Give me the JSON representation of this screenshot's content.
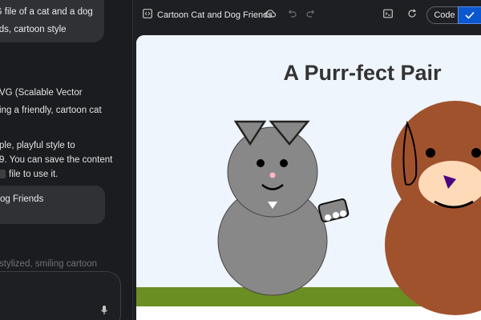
{
  "chat": {
    "request_text": "VG file of a cat and a dog\nends, cartoon style",
    "response_line1": "VG (Scalable Vector",
    "response_line2": "ing a friendly, cartoon cat",
    "response_line3": "ple, playful style to",
    "response_line4": "9. You can save the content",
    "response_line5": "file to use it.",
    "file_chip_label": "og Friends",
    "hint_text": "stylized, smiling cartoon",
    "mic_icon": "mic-icon"
  },
  "toolbar": {
    "doc_icon": "code-doc-icon",
    "title": "Cartoon Cat and Dog Friends",
    "cloud_icon": "cloud-sync-icon",
    "undo_icon": "undo-icon",
    "redo_icon": "redo-icon",
    "terminal_icon": "terminal-icon",
    "refresh_icon": "refresh-icon",
    "code_label": "Code",
    "preview_icon": "check-icon"
  },
  "canvas": {
    "heading": "A Purr-fect Pair",
    "sky_color": "#eef5fd",
    "grass_color": "#6b8e23",
    "cat_color": "#888888",
    "dog_color": "#a0522d",
    "dog_muzzle_color": "#ffdab9",
    "dog_nose_color": "#4b0082"
  }
}
